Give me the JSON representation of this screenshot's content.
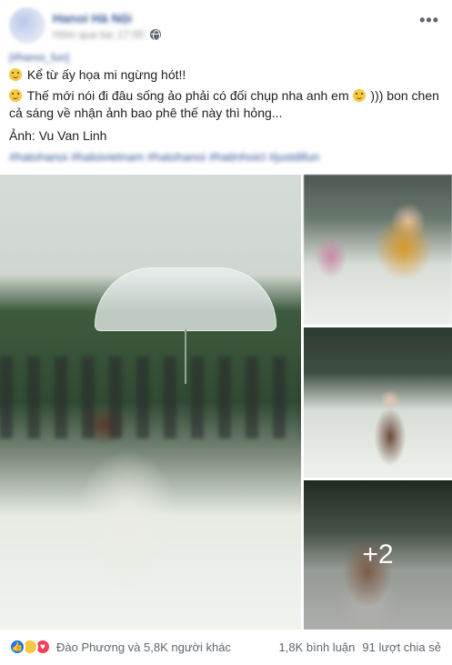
{
  "post": {
    "page_name": "Hanoi Hà Nội",
    "timestamp": "Hôm qua lúc 17:00",
    "tag": "[#hanoi_fun]",
    "line1": "Kể từ ấy họa mi ngừng hót!!",
    "line2_a": "Thế mới nói đi đâu sống ảo phải có đối chụp nha anh em",
    "line2_b": "))) bon chen cả sáng về nhận ảnh bao phê thế này thì hỏng...",
    "credit": "Ảnh: Vu Van Linh",
    "hashtags": "#hatohanoi #haloivietnam #hatohanoi #hatinhoicl #justdifun"
  },
  "photos": {
    "more_count": "+2"
  },
  "footer": {
    "reactions_text": "Đào Phương và 5,8K người khác",
    "comments": "1,8K bình luận",
    "shares": "91 lượt chia sẻ"
  },
  "icons": {
    "privacy": "globe-icon",
    "menu": "more-icon",
    "reactions": [
      "like-icon",
      "haha-icon",
      "love-icon"
    ],
    "emoji": "smile-emoji-icon"
  },
  "colors": {
    "link": "#385898",
    "like": "#1877f2",
    "love": "#f33e58",
    "haha": "#f7c843"
  }
}
